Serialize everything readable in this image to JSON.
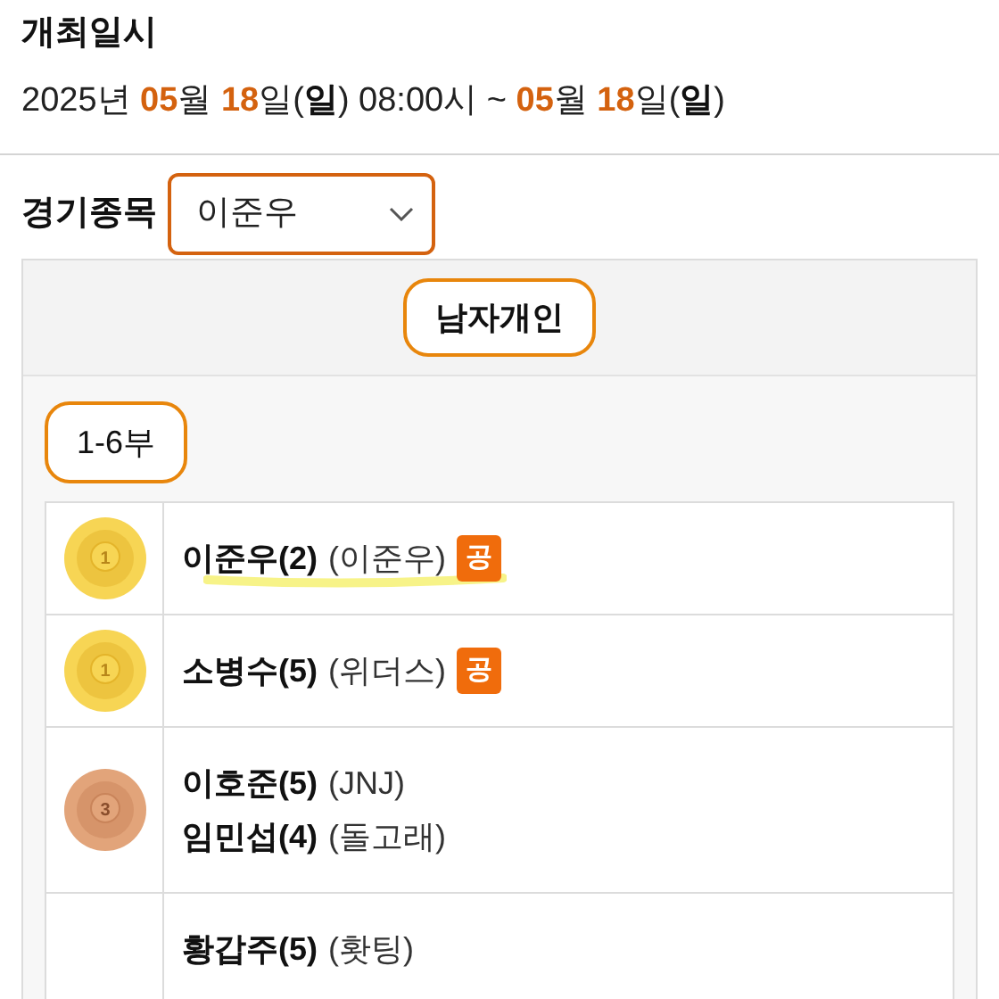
{
  "schedule": {
    "title": "개최일시",
    "date_parts": [
      {
        "kind": "plain",
        "text": "2025년 "
      },
      {
        "kind": "num",
        "text": "05"
      },
      {
        "kind": "plain",
        "text": "월 "
      },
      {
        "kind": "num",
        "text": "18"
      },
      {
        "kind": "plain",
        "text": "일("
      },
      {
        "kind": "bold",
        "text": "일"
      },
      {
        "kind": "plain",
        "text": ") 08:00시 ~ "
      },
      {
        "kind": "num",
        "text": "05"
      },
      {
        "kind": "plain",
        "text": "월 "
      },
      {
        "kind": "num",
        "text": "18"
      },
      {
        "kind": "plain",
        "text": "일("
      },
      {
        "kind": "bold",
        "text": "일"
      },
      {
        "kind": "plain",
        "text": ")"
      }
    ]
  },
  "event": {
    "label": "경기종목",
    "value": "이준우"
  },
  "category": "남자개인",
  "division": "1-6부",
  "results": [
    {
      "medal": "1",
      "players": [
        {
          "name": "이준우(2)",
          "club": "(이준우)",
          "badge": "공",
          "highlighted": true
        }
      ]
    },
    {
      "medal": "1",
      "players": [
        {
          "name": "소병수(5)",
          "club": "(위더스)",
          "badge": "공",
          "highlighted": false
        }
      ]
    },
    {
      "medal": "3",
      "players": [
        {
          "name": "이호준(5)",
          "club": "(JNJ)",
          "highlighted": false
        },
        {
          "name": "임민섭(4)",
          "club": "(돌고래)",
          "highlighted": false
        }
      ]
    },
    {
      "players": [
        {
          "name": "황갑주(5)",
          "club": "(홧팅)",
          "highlighted": false
        }
      ]
    }
  ]
}
